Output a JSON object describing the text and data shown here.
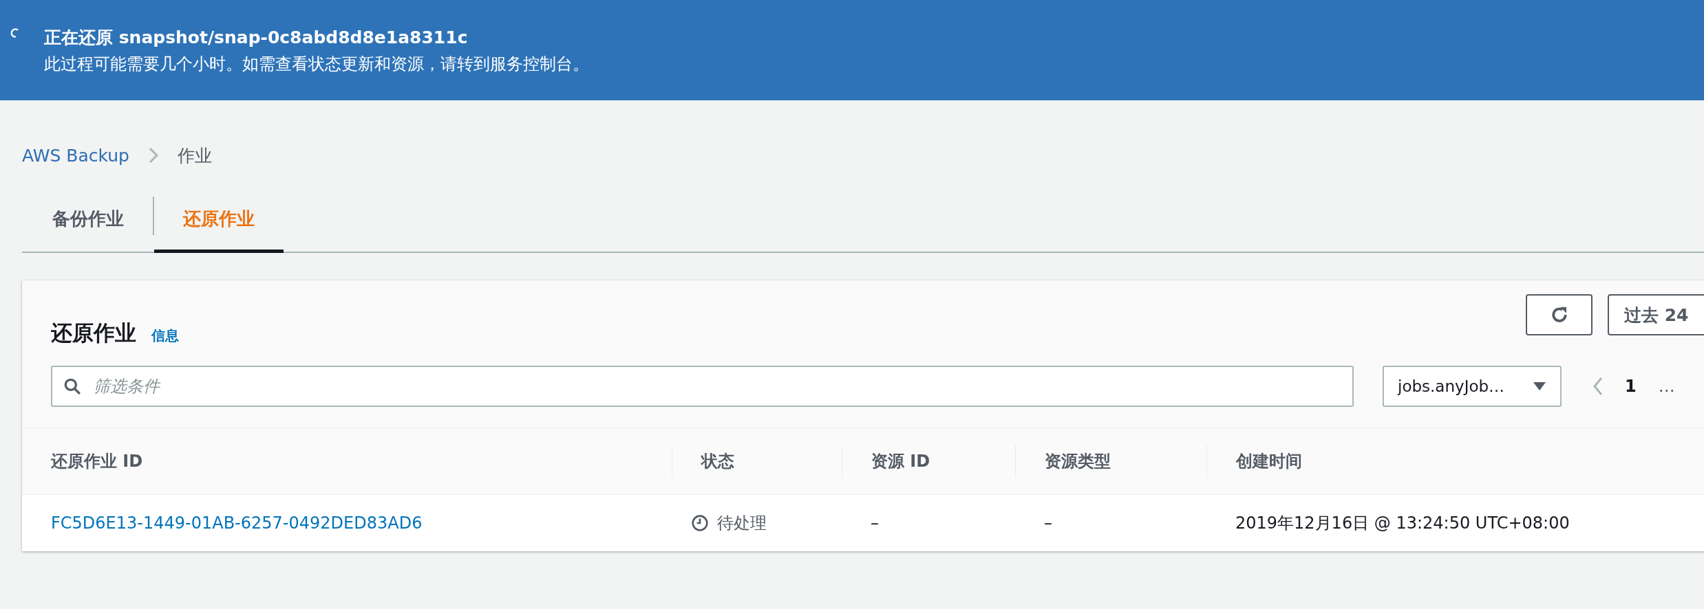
{
  "banner": {
    "title": "正在还原 snapshot/snap-0c8abd8d8e1a8311c",
    "message": "此过程可能需要几个小时。如需查看状态更新和资源，请转到服务控制台。"
  },
  "breadcrumbs": [
    {
      "label": "AWS Backup",
      "link": true
    },
    {
      "label": "作业",
      "link": false
    }
  ],
  "tabs": [
    {
      "label": "备份作业",
      "selected": false
    },
    {
      "label": "还原作业",
      "selected": true
    }
  ],
  "panel": {
    "title": "还原作业",
    "info_link": "信息",
    "time_range_button": "过去 24",
    "filter": {
      "placeholder": "筛选条件"
    },
    "dropdown": {
      "value": "jobs.anyJob…"
    },
    "pagination": {
      "prev_disabled": true,
      "pages": [
        {
          "label": "1",
          "selected": true
        },
        {
          "label": "…",
          "selected": false
        }
      ]
    }
  },
  "table": {
    "columns": [
      "还原作业 ID",
      "状态",
      "资源 ID",
      "资源类型",
      "创建时间"
    ],
    "rows": [
      {
        "job_id": "FC5D6E13-1449-01AB-6257-0492DED83AD6",
        "status": {
          "text": "待处理",
          "kind": "pending"
        },
        "resource_id": "–",
        "resource_type": "–",
        "created": "2019年12月16日 @ 13:24:50 UTC+08:00"
      }
    ]
  }
}
